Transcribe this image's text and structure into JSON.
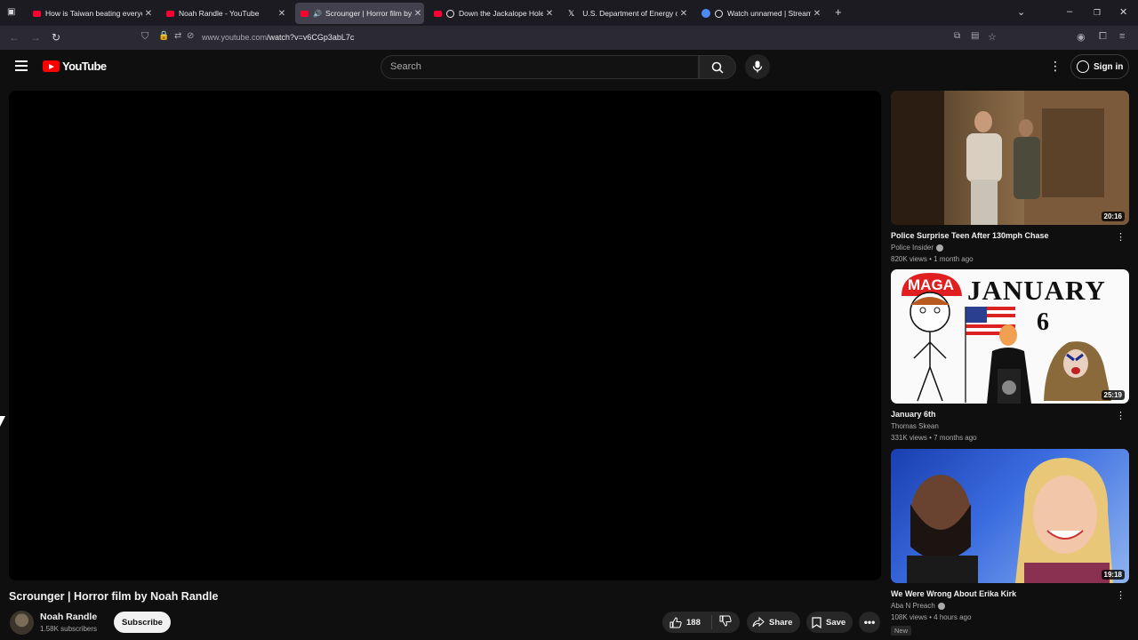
{
  "browser": {
    "tabs": [
      {
        "title": "How is Taiwan beating everyone",
        "favicon": "youtube-icon"
      },
      {
        "title": "Noah Randle - YouTube",
        "favicon": "youtube-icon"
      },
      {
        "title": "Scrounger | Horror film by N",
        "favicon": "youtube-icon",
        "active": true,
        "audio": true
      },
      {
        "title": "Down the Jackalope Hole |",
        "favicon": "youtube-icon"
      },
      {
        "title": "U.S. Department of Energy on X",
        "favicon": "x-icon"
      },
      {
        "title": "Watch unnamed | Streamab",
        "favicon": "streamable-icon"
      }
    ],
    "url_host": "www.youtube.com",
    "url_path": "/watch?v=v6CGp3abL7c"
  },
  "youtube": {
    "logo_text": "YouTube",
    "search_placeholder": "Search",
    "signin_label": "Sign in"
  },
  "video": {
    "title": "Scrounger | Horror film by Noah Randle",
    "channel": "Noah Randle",
    "subscribers": "1.58K subscribers",
    "subscribe_label": "Subscribe",
    "likes": "188",
    "share_label": "Share",
    "save_label": "Save"
  },
  "recommendations": [
    {
      "title": "Police Surprise Teen After 130mph Chase",
      "channel": "Police Insider",
      "verified": true,
      "meta": "820K views • 1 month ago",
      "duration": "20:16"
    },
    {
      "title": "January 6th",
      "channel": "Thomas Skean",
      "verified": false,
      "meta": "331K views • 7 months ago",
      "duration": "25:19",
      "thumb_text_left": "MAGA",
      "thumb_text_right": "JANUARY",
      "thumb_number": "6"
    },
    {
      "title": "We Were Wrong About Erika Kirk",
      "channel": "Aba N Preach",
      "verified": true,
      "meta": "108K views • 4 hours ago",
      "duration": "19:18",
      "badge": "New"
    }
  ]
}
